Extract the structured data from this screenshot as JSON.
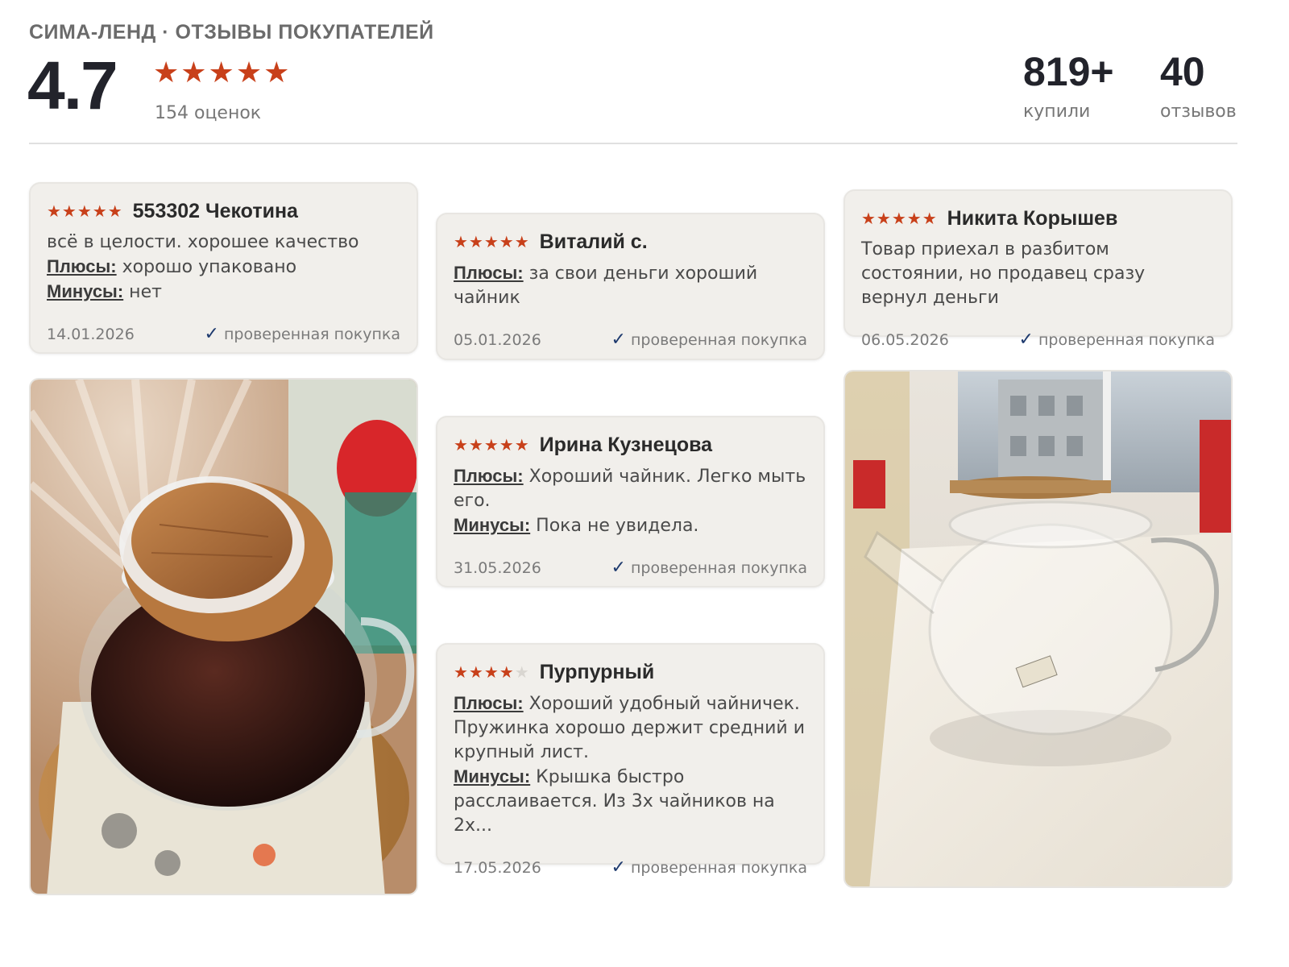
{
  "header": {
    "title": "СИМА-ЛЕНД · ОТЗЫВЫ ПОКУПАТЕЛЕЙ",
    "rating": "4.7",
    "stars": "★★★★★",
    "rating_count": "154 оценок",
    "bought_value": "819+",
    "bought_label": "купили",
    "reviews_value": "40",
    "reviews_label": "отзывов"
  },
  "colors": {
    "star": "#c8401a",
    "card_bg": "#f1efeb",
    "check": "#1e3a6e"
  },
  "reviews": [
    {
      "stars_on": "★★★★★",
      "stars_off": "",
      "author": "553302 Чекотина",
      "text": "всё в целости. хорошее качество",
      "plus_label": "Плюсы:",
      "plus": " хорошо упаковано",
      "minus_label": "Минусы:",
      "minus": " нет",
      "date": "14.01.2026",
      "verified": "проверенная покупка"
    },
    {
      "stars_on": "★★★★★",
      "stars_off": "",
      "author": "Виталий с.",
      "plus_label": "Плюсы:",
      "plus": " за свои деньги хороший чайник",
      "date": "05.01.2026",
      "verified": "проверенная покупка"
    },
    {
      "stars_on": "★★★★★",
      "stars_off": "",
      "author": "Никита Корышев",
      "text": "Товар приехал в разбитом состоянии, но продавец сразу вернул деньги",
      "date": "06.05.2026",
      "verified": "проверенная покупка"
    },
    {
      "stars_on": "★★★★★",
      "stars_off": "",
      "author": "Ирина Кузнецова",
      "plus_label": "Плюсы:",
      "plus": " Хороший чайник. Легко мыть его.",
      "minus_label": "Минусы:",
      "minus": " Пока не увидела.",
      "date": "31.05.2026",
      "verified": "проверенная покупка"
    },
    {
      "stars_on": "★★★★",
      "stars_off": "★",
      "author": "Пурпурный",
      "plus_label": "Плюсы:",
      "plus": " Хороший удобный чайничек. Пружинка хорошо держит средний и крупный лист.",
      "minus_label": "Минусы:",
      "minus": " Крышка быстро расслаивается. Из 3х чайников на 2х...",
      "date": "17.05.2026",
      "verified": "проверенная покупка"
    }
  ]
}
